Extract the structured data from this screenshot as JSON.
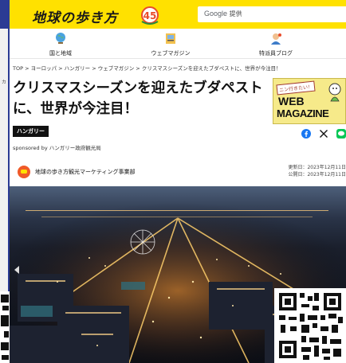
{
  "site": {
    "logo_text": "地球の歩き方",
    "logo_anniversary": "45",
    "search_brand": "Google",
    "search_brand_suffix": "提供"
  },
  "left_ghost": "カ",
  "nav": [
    {
      "label": "国と地域",
      "icon": "globe-icon"
    },
    {
      "label": "ウェブマガジン",
      "icon": "magazine-icon"
    },
    {
      "label": "特派員ブログ",
      "icon": "correspondent-icon"
    }
  ],
  "breadcrumb": "TOP > ヨーロッパ > ハンガリー > ウェブマガジン > クリスマスシーズンを迎えたブダペストに、世界が今注目！",
  "article": {
    "title": "クリスマスシーズンを迎えたブダペストに、世界が今注目！",
    "country_badge": "ハンガリー",
    "sponsored": "sponsored by ハンガリー政府観光局",
    "author": "地球の歩き方観光マーケティング事業部",
    "updated": "更新日：2023年12月11日",
    "published": "公開日：2023年12月11日"
  },
  "webmag": {
    "tag": "ニン行きたい！",
    "line1": "WEB",
    "line2": "MAGAZINE"
  },
  "share": [
    "facebook-icon",
    "x-icon",
    "line-icon"
  ],
  "colors": {
    "header_yellow": "#ffe100",
    "frame_blue": "#2b3b94",
    "facebook": "#1877f2",
    "line": "#06c755"
  }
}
